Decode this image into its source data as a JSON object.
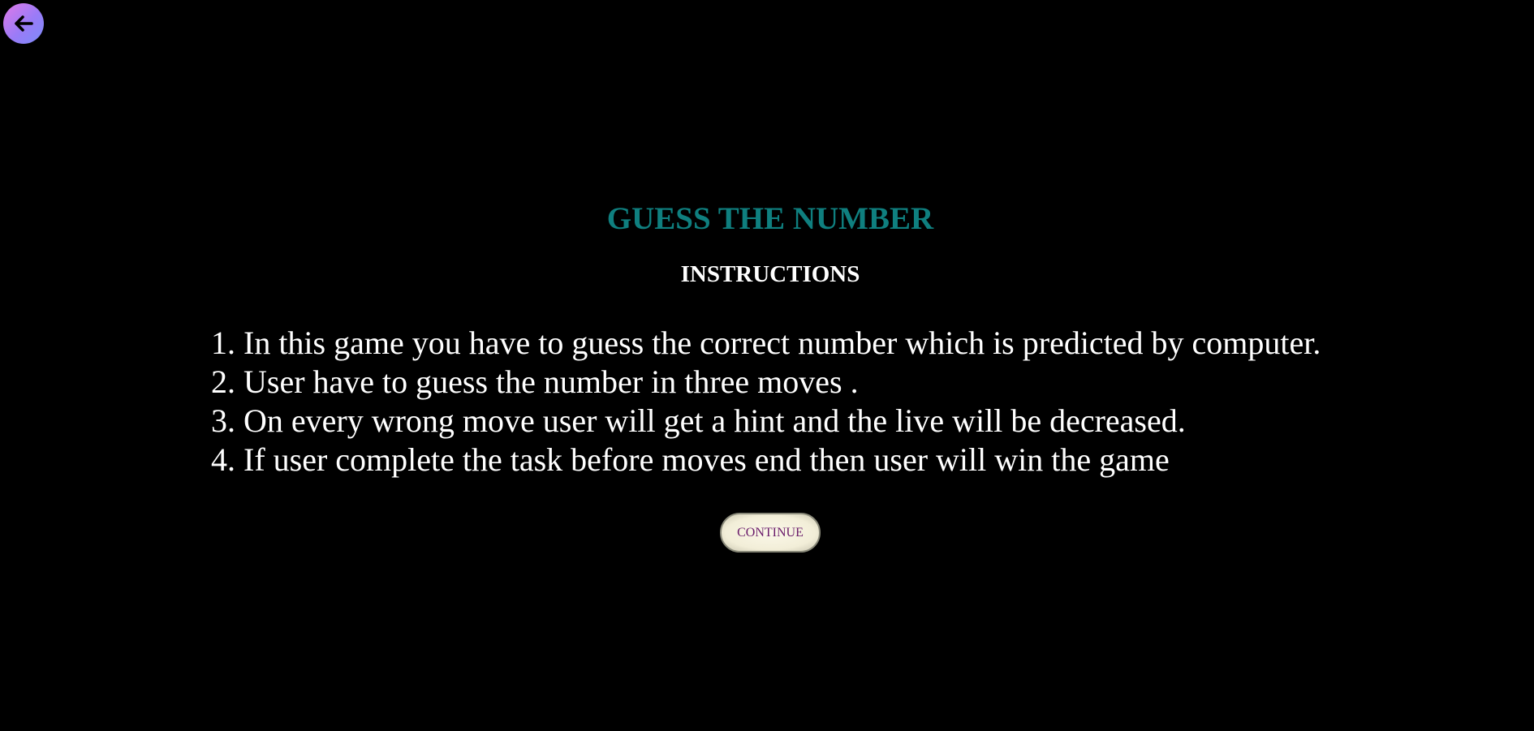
{
  "header": {
    "back_icon": "arrow-left-icon",
    "back_gradient": [
      "#e07ae8",
      "#7b8cf9"
    ]
  },
  "game": {
    "title": "GUESS THE NUMBER",
    "subtitle": "INSTRUCTIONS",
    "instructions": [
      "1. In this game you have to guess the correct number which is predicted by computer.",
      "2. User have to guess the number in three moves .",
      "3. On every wrong move user will get a hint and the live will be decreased.",
      "4. If user complete the task before moves end then user will win the game"
    ],
    "continue_label": "CONTINUE"
  },
  "colors": {
    "background": "#000000",
    "title": "#0f7f7f",
    "text": "#ffffff",
    "button_text": "#6a1b6a"
  }
}
